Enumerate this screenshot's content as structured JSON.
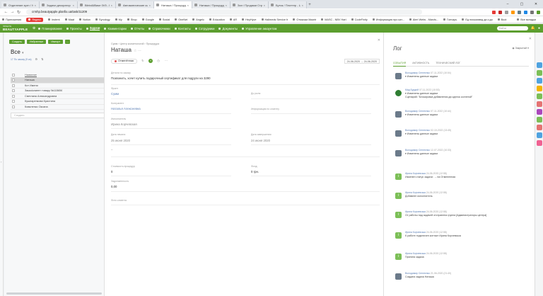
{
  "browser": {
    "tabs": [
      {
        "title": "Отделение кухн / УправМоеУ"
      },
      {
        "title": "Задачи декоратор 'кол-свет"
      },
      {
        "title": "BitrixAllBase 0V5 - Розетка"
      },
      {
        "title": "Автоматические сценарии ф"
      },
      {
        "title": "Наташа / Процедура / Сумм"
      },
      {
        "title": "Наташа / Процедура / Сумм"
      },
      {
        "title": "Зал / Продажи Страховка"
      },
      {
        "title": "Бутик / Плоттер - Центр"
      }
    ],
    "active_tab_index": 4,
    "url": "сrmhp.beautyapple.planfix.ua/task/11209",
    "bookmarks": [
      "Приложения",
      "Яндекс",
      "Instrmt",
      "Maat",
      "Notion",
      "Synology",
      "My",
      "Shop",
      "Google",
      "Social",
      "OneNet",
      "Angelc",
      "Education",
      "AR",
      "HeyHyve",
      "Hallmeds Service fr",
      "Отмычки Maartr",
      "MASC - NBV Hart",
      "CodeFinity",
      "Информация про кат...",
      "Alert Webs - Marcts...",
      "Гончарь",
      "Ед письмовед да к да",
      "Boot",
      "Все вкладки"
    ],
    "extension_colors": [
      "#e53935",
      "#c62828",
      "#9e9e9e",
      "#ff9800",
      "#607d8b",
      "#1e88e5",
      "#757575",
      "#5c9e2f"
    ]
  },
  "app": {
    "logo_small": "ПРОЕКТЫ",
    "logo": "BEAUTYAPPLE",
    "nav": [
      "Планирование",
      "Проекты",
      "Задачи",
      "Комментарии",
      "Отчеты",
      "Справочники",
      "Контакты",
      "Сотрудники",
      "Документы",
      "Управление аккаунтом"
    ],
    "active_nav_index": 2,
    "search_placeholder": "Найти"
  },
  "list": {
    "buttons": [
      "Создать",
      "Избранные",
      "Импорт",
      "..."
    ],
    "title": "Все",
    "title_marker": "▾",
    "subtitle": "17 По заказу (9 из)",
    "column_header": "Название",
    "rows": [
      "Наташа",
      "Кот Имени",
      "Заказ/клиент товару №115656",
      "Светлана Александровна",
      "Кушнаренкова Кристина",
      "Коваленко Оксана"
    ],
    "selected_index": 0,
    "highlighted_index": 0,
    "search_placeholder": "Создать"
  },
  "task": {
    "breadcrumbs": "Сумм › Центр косметологий › Процедура",
    "title": "Наташа",
    "title_icons": "☆ ···",
    "status": "Отменённая",
    "date_range": "24-06-2020 → 24-06-2020",
    "description_label": "Детали по заказу",
    "description": "Позвонить, хочет купить подарочный сертификат для подруги на 3290",
    "fields": {
      "project_label": "Фронт",
      "project_value": "Сумм",
      "counterparty_label": "До рынк",
      "counterparty_value": "",
      "contact_label": "Контрагент",
      "contact_value": "Наталья Алексеевна",
      "info_label": "Информация по клиенту",
      "info_value": "",
      "executor_label": "Исполнитель",
      "executor_value": "Ирина Корчевская",
      "start_label": "Дата начала",
      "start_value": "25 июня 2020",
      "end_label": "Дата завершения",
      "end_value": "24 июня 2020",
      "dash": "–",
      "cost_label": "Стоимость процедур",
      "cost_value": "0",
      "pay_label": "Фонд",
      "pay_value": "0",
      "pay_unit": "грн.",
      "debt_label": "Задолженность",
      "debt_value": "0,00",
      "photo_label": "Фото клиента"
    }
  },
  "log": {
    "title": "Лог",
    "filter": "Закрытый",
    "tabs": [
      "СОБЫТИЯ",
      "АКТИВНОСТЬ",
      "ТЕХНИЧЕСКИЙ ЛОГ"
    ],
    "entries": [
      {
        "author": "Володимир Сенгеєнко",
        "time": "07-11-2022 (10:04)",
        "text": "▾ Изменены данные задачи",
        "text2": "",
        "avatar": "photo"
      },
      {
        "author": "Мад Бурдей",
        "time": "07-11-2022 (10:53)",
        "text": "▾ Изменены данные задачи",
        "text2": "Сценарий: \"Блокировка добавления да сделок коллегой\"",
        "avatar": "logo"
      },
      {
        "author": "Володимир Сенгеєнко",
        "time": "07-11-2022 (10:44)",
        "text": "▾ Изменены данные задачи",
        "text2": "",
        "avatar": "photo"
      },
      {
        "author": "Володимир Сенгеєнко",
        "time": "02-10-2022 (13:45)",
        "text": "▾ Изменены данные задачи",
        "text2": "",
        "avatar": "photo"
      },
      {
        "author": "Володимир Сенгеєнко",
        "time": "12-07-2022 (10:33)",
        "text": "▾ Изменены данные задачи",
        "text2": "",
        "avatar": "photo"
      },
      {
        "author": "Ирина Корчевська",
        "time": "24-06-2020 (12:58)",
        "text": "Изменен статус задачи: → на Отмененная",
        "text2": "",
        "avatar": "sys"
      },
      {
        "author": "Ирина Корчевська",
        "time": "24-06-2020 (12:58)",
        "text": "Добавлен исполнитель",
        "text2": "",
        "avatar": "sys"
      },
      {
        "author": "Ирина Корчевська",
        "time": "24-06-2020 (12:58)",
        "text": "От работы над задачей отстранена группа [Администраторы центра]",
        "text2": "",
        "avatar": "sys"
      },
      {
        "author": "Ирина Корчевська",
        "time": "24-06-2020 (12:58)",
        "text": "К работе подключен контакт Ирина Корчевська",
        "text2": "",
        "avatar": "sys"
      },
      {
        "author": "Ирина Корчевська",
        "time": "24-06-2020 (12:58)",
        "text": "Принята задача",
        "text2": "",
        "avatar": "sys"
      },
      {
        "author": "Володимир Сенгеєнко",
        "time": "21-06-2020 (21:40)",
        "text": "Создана задача Наташа",
        "text2": "",
        "avatar": "photo"
      }
    ]
  },
  "right_icons": [
    "#4fa3e0",
    "#7cbf57",
    "#4fa3e0",
    "#f4b400",
    "#7cbf57",
    "#e57373",
    "#ab47bc",
    "#7cbf57",
    "#e57373",
    "#4fa3e0",
    "#f06292"
  ]
}
